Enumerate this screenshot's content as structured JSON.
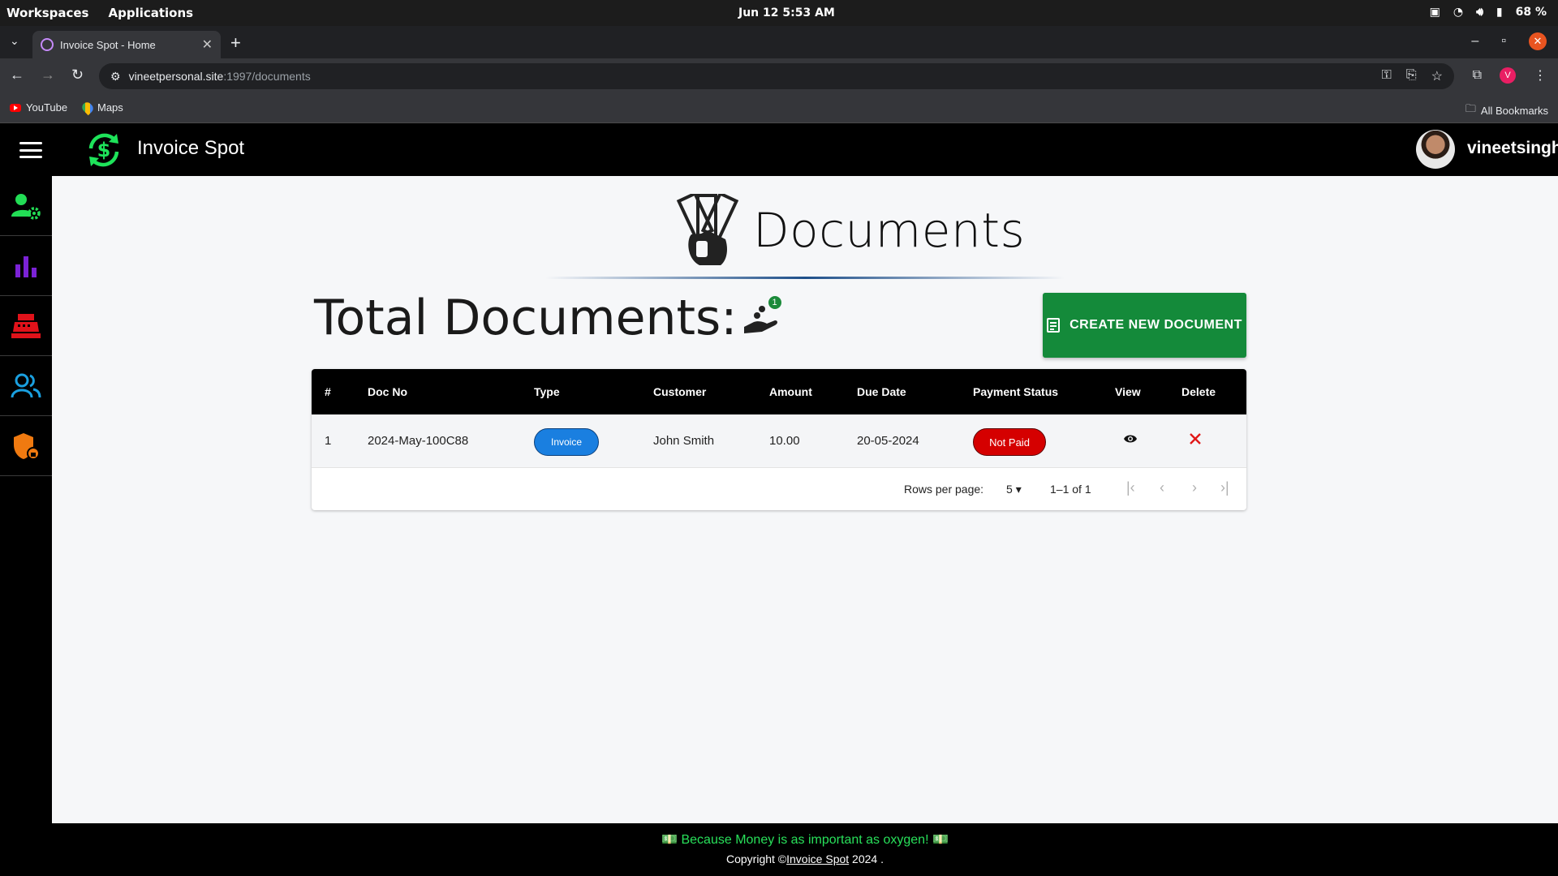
{
  "os": {
    "workspaces": "Workspaces",
    "applications": "Applications",
    "datetime": "Jun 12  5:53 AM",
    "battery": "68 %"
  },
  "browser": {
    "tab_title": "Invoice Spot - Home",
    "url_host": "vineetpersonal.site",
    "url_path": ":1997/documents",
    "profile_initial": "V",
    "bookmarks": [
      "YouTube",
      "Maps"
    ],
    "all_bookmarks": "All Bookmarks"
  },
  "app": {
    "title": "Invoice Spot",
    "username": "vineetsingh",
    "accent": "#1ee35a"
  },
  "sidebar": {
    "items": [
      {
        "icon": "user-settings-icon",
        "color": "#22dd55"
      },
      {
        "icon": "bar-chart-icon",
        "color": "#7b22d6"
      },
      {
        "icon": "cash-register-icon",
        "color": "#e0121a"
      },
      {
        "icon": "users-icon",
        "color": "#1aa0e0"
      },
      {
        "icon": "shield-lock-icon",
        "color": "#f07a10"
      }
    ]
  },
  "page": {
    "heading": "Documents",
    "total_label": "Total Documents:",
    "total_count": "1",
    "create_button": "CREATE NEW DOCUMENT"
  },
  "table": {
    "columns": [
      "#",
      "Doc No",
      "Type",
      "Customer",
      "Amount",
      "Due Date",
      "Payment Status",
      "View",
      "Delete"
    ],
    "rows": [
      {
        "index": "1",
        "doc_no": "2024-May-100C88",
        "type": "Invoice",
        "customer": "John Smith",
        "amount": "10.00",
        "due_date": "20-05-2024",
        "payment_status": "Not Paid"
      }
    ],
    "rows_per_page_label": "Rows per page:",
    "rows_per_page": "5",
    "range": "1–1 of 1"
  },
  "footer": {
    "slogan": "💵 Because Money is as important as oxygen! 💵",
    "copyright_prefix": "Copyright ©",
    "copyright_link": "Invoice Spot",
    "copyright_suffix": " 2024 ."
  }
}
